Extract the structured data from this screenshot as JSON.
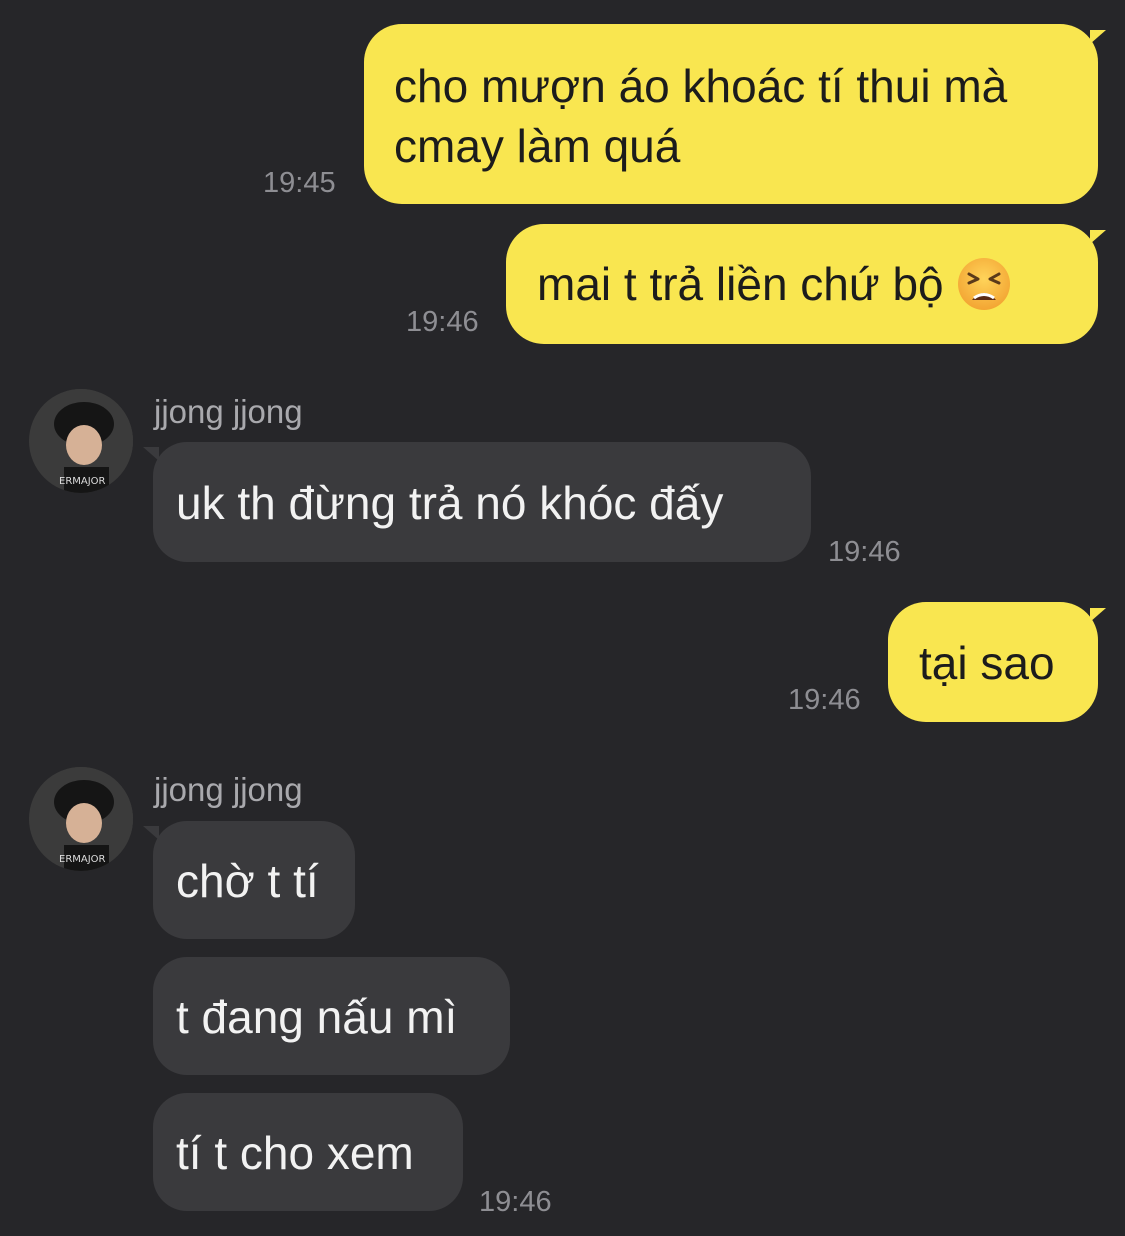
{
  "colors": {
    "background": "#262629",
    "outgoing": "#f9e650",
    "incoming": "#3a3a3d",
    "timestamp": "#8e8e93"
  },
  "messages": [
    {
      "direction": "out",
      "lines": [
        "cho mượn áo khoác tí thui mà",
        "cmay làm quá"
      ],
      "time": "19:45"
    },
    {
      "direction": "out",
      "text": "mai t trả liền chứ bộ",
      "emoji": "tired-face-emoji",
      "time": "19:46"
    },
    {
      "direction": "in",
      "sender": "jjong jjong",
      "text": "uk th đừng trả nó khóc đấy",
      "time": "19:46"
    },
    {
      "direction": "out",
      "text": "tại sao",
      "time": "19:46"
    },
    {
      "direction": "in",
      "sender": "jjong jjong",
      "texts": [
        "chờ t tí",
        "t đang nấu mì",
        "tí t cho xem"
      ],
      "time": "19:46"
    }
  ]
}
